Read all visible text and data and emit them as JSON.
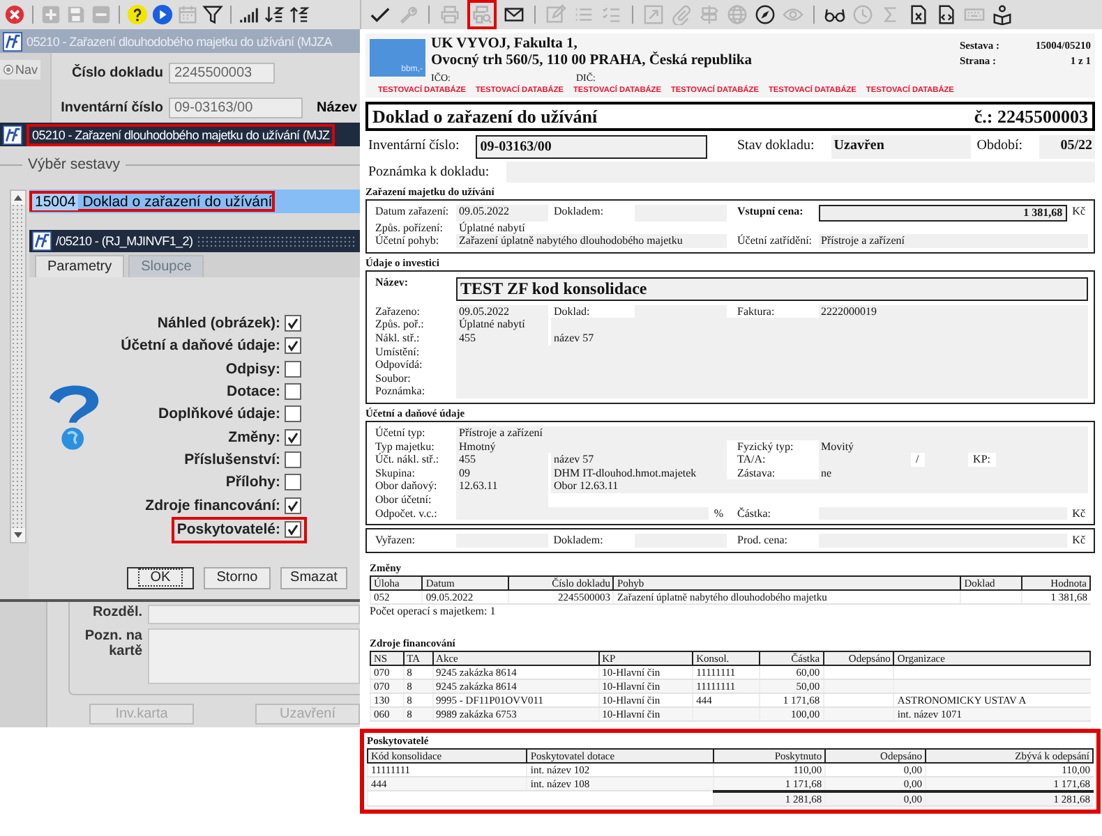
{
  "left": {
    "toolbar": [
      {
        "kind": "close",
        "disabled": false
      },
      {
        "kind": "separator"
      },
      {
        "kind": "add",
        "disabled": true
      },
      {
        "kind": "save",
        "disabled": true
      },
      {
        "kind": "remove",
        "disabled": true
      },
      {
        "kind": "separator"
      },
      {
        "kind": "help",
        "disabled": false
      },
      {
        "kind": "play",
        "disabled": false
      },
      {
        "kind": "calendar",
        "disabled": true
      },
      {
        "kind": "filter",
        "disabled": false
      },
      {
        "kind": "separator"
      },
      {
        "kind": "signal",
        "disabled": false
      },
      {
        "kind": "sort-down",
        "disabled": false
      },
      {
        "kind": "sort-up",
        "disabled": false
      }
    ],
    "back_window": {
      "title": "05210 - Zařazení dlouhodobého majetku do užívání (MJZA",
      "nav_button": "Nav",
      "fields": [
        {
          "label": "Číslo dokladu",
          "value": "2245500003"
        },
        {
          "label": "Inventární číslo",
          "value": "09-03163/00"
        }
      ],
      "cut_label": "Název"
    },
    "dialog": {
      "title": "05210 - Zařazení dlouhodobého majetku do užívání (MJZ",
      "highlighted": true,
      "group_label": "Výběr sestavy",
      "reports": [
        {
          "code": "15004",
          "name": "Doklad o zařazení do užívání",
          "selected": true,
          "highlighted": true
        }
      ],
      "subtitle": "/05210 - (RJ_MJINVF1_2)",
      "tabs": [
        {
          "label": "Parametry",
          "selected": true,
          "disabled": false
        },
        {
          "label": "Sloupce",
          "selected": false,
          "disabled": true
        }
      ],
      "options": [
        {
          "label": "Náhled (obrázek):",
          "checked": true,
          "highlighted": false
        },
        {
          "label": "Účetní a daňové údaje:",
          "checked": true,
          "highlighted": false
        },
        {
          "label": "Odpisy:",
          "checked": false,
          "highlighted": false
        },
        {
          "label": "Dotace:",
          "checked": false,
          "highlighted": false
        },
        {
          "label": "Doplňkové údaje:",
          "checked": false,
          "highlighted": false
        },
        {
          "label": "Změny:",
          "checked": true,
          "highlighted": false
        },
        {
          "label": "Příslušenství:",
          "checked": false,
          "highlighted": false
        },
        {
          "label": "Přílohy:",
          "checked": false,
          "highlighted": false
        },
        {
          "label": "Zdroje financování:",
          "checked": true,
          "highlighted": false
        },
        {
          "label": "Poskytovatelé:",
          "checked": true,
          "highlighted": true
        }
      ],
      "buttons": [
        {
          "label": "OK",
          "focused": true
        },
        {
          "label": "Storno",
          "focused": false
        },
        {
          "label": "Smazat",
          "focused": false
        }
      ]
    },
    "lower_form": {
      "fields": [
        {
          "label": "Rozděl.",
          "kind": "line"
        },
        {
          "label": "Pozn. na kartě",
          "kind": "area"
        }
      ],
      "buttons": [
        {
          "label": "Inv.karta",
          "disabled": true
        },
        {
          "label": "Uzavření",
          "disabled": true
        }
      ]
    }
  },
  "preview": {
    "toolbar": [
      {
        "kind": "check",
        "disabled": false,
        "highlighted": false
      },
      {
        "kind": "wrench",
        "disabled": true,
        "highlighted": false
      },
      {
        "kind": "separator"
      },
      {
        "kind": "print",
        "disabled": true,
        "highlighted": false
      },
      {
        "kind": "preview",
        "disabled": true,
        "highlighted": true
      },
      {
        "kind": "mail",
        "disabled": false,
        "highlighted": false
      },
      {
        "kind": "separator"
      },
      {
        "kind": "edit",
        "disabled": true,
        "highlighted": false
      },
      {
        "kind": "list",
        "disabled": true,
        "highlighted": false
      },
      {
        "kind": "checklist",
        "disabled": true,
        "highlighted": false
      },
      {
        "kind": "separator"
      },
      {
        "kind": "export",
        "disabled": true,
        "highlighted": false
      },
      {
        "kind": "clip",
        "disabled": true,
        "highlighted": false
      },
      {
        "kind": "signpost",
        "disabled": true,
        "highlighted": false
      },
      {
        "kind": "globe",
        "disabled": true,
        "highlighted": false
      },
      {
        "kind": "compass",
        "disabled": false,
        "highlighted": false
      },
      {
        "kind": "eye",
        "disabled": true,
        "highlighted": false
      },
      {
        "kind": "separator"
      },
      {
        "kind": "glasses",
        "disabled": false,
        "highlighted": false
      },
      {
        "kind": "clock",
        "disabled": true,
        "highlighted": false
      },
      {
        "kind": "sigma",
        "disabled": true,
        "highlighted": false
      },
      {
        "kind": "excel",
        "disabled": false,
        "highlighted": false
      },
      {
        "kind": "code",
        "disabled": false,
        "highlighted": false
      },
      {
        "kind": "keyboard",
        "disabled": true,
        "highlighted": false
      },
      {
        "kind": "reader",
        "disabled": false,
        "highlighted": false
      }
    ],
    "report": {
      "logo_text": "bbm,-",
      "company_lines": [
        "UK VYVOJ, Fakulta 1,",
        "Ovocný trh 560/5, 110 00 PRAHA, Česká republika"
      ],
      "ids": [
        "IČO:",
        "DIČ:"
      ],
      "meta": [
        {
          "label": "Sestava :",
          "value": "15004/05210"
        },
        {
          "label": "Strana :",
          "value": "1 z 1"
        }
      ],
      "test_banners": [
        "TESTOVACÍ DATABÁZE",
        "TESTOVACÍ DATABÁZE",
        "TESTOVACÍ DATABÁZE",
        "TESTOVACÍ DATABÁZE",
        "TESTOVACÍ DATABÁZE",
        "TESTOVACÍ DATABÁZE"
      ],
      "title": "Doklad o zařazení do užívání",
      "number": "č.: 2245500003",
      "sections": [
        {
          "kind": "plain",
          "rows": [
            {
              "left": [
                {
                  "kind": "label",
                  "text": "Inventární číslo:"
                },
                {
                  "kind": "boxed",
                  "text": "09-03163/00"
                }
              ],
              "right": [
                {
                  "kind": "label",
                  "text": "Stav dokladu:"
                },
                {
                  "kind": "strong-value",
                  "text": "Uzavřen"
                },
                {
                  "kind": "label",
                  "text": "Období:"
                },
                {
                  "kind": "strong-value",
                  "text": "05/22"
                }
              ]
            },
            {
              "left": [
                {
                  "kind": "label",
                  "text": "Poznámka k dokladu:"
                },
                {
                  "kind": "fill"
                }
              ]
            }
          ]
        },
        {
          "kind": "box",
          "title": "Zařazení majetku do užívání",
          "rows": [
            {
              "left": [
                {
                  "kind": "label",
                  "text": "Datum zařazení:"
                },
                {
                  "kind": "value",
                  "text": "09.05.2022"
                },
                {
                  "kind": "label",
                  "text": "Dokladem:"
                },
                {
                  "kind": "fill"
                }
              ],
              "right": [
                {
                  "kind": "strong",
                  "text": "Vstupní cena:"
                },
                {
                  "kind": "amount",
                  "text": "1 381,68"
                },
                {
                  "kind": "unit",
                  "text": "Kč"
                }
              ]
            },
            {
              "left": [
                {
                  "kind": "label",
                  "text": "Způs. pořízení:"
                },
                {
                  "kind": "text",
                  "text": "Úplatné nabytí"
                }
              ]
            },
            {
              "left": [
                {
                  "kind": "label",
                  "text": "Účetní pohyb:"
                },
                {
                  "kind": "fill",
                  "text": "Zařazení úplatně nabytého dlouhodobého majetku"
                }
              ],
              "right": [
                {
                  "kind": "label",
                  "text": "Účetní zatřídění:"
                },
                {
                  "kind": "fill",
                  "text": "Přístroje a zařízení"
                }
              ]
            }
          ]
        },
        {
          "kind": "box",
          "title": "Údaje o investici",
          "rows": [
            {
              "left": [
                {
                  "kind": "strong",
                  "text": "Název:"
                },
                {
                  "kind": "headline",
                  "text": "TEST ZF kod konsolidace"
                }
              ]
            },
            {
              "left": [
                {
                  "kind": "label",
                  "text": "Zařazeno:"
                },
                {
                  "kind": "value",
                  "text": "09.05.2022"
                },
                {
                  "kind": "label",
                  "text": "Doklad:"
                },
                {
                  "kind": "fill"
                }
              ],
              "right": [
                {
                  "kind": "label",
                  "text": "Faktura:"
                },
                {
                  "kind": "fill",
                  "text": "2222000019"
                }
              ]
            },
            {
              "left": [
                {
                  "kind": "label",
                  "text": "Způs. poř.:"
                },
                {
                  "kind": "value",
                  "text": "Úplatné nabytí"
                },
                {
                  "kind": "fill"
                }
              ]
            },
            {
              "left": [
                {
                  "kind": "label",
                  "text": "Nákl. stř.:"
                },
                {
                  "kind": "value",
                  "text": "455"
                },
                {
                  "kind": "fill",
                  "text": "název 57"
                }
              ]
            },
            {
              "left": [
                {
                  "kind": "label",
                  "text": "Umístění:"
                },
                {
                  "kind": "fill"
                }
              ]
            },
            {
              "left": [
                {
                  "kind": "label",
                  "text": "Odpovídá:"
                },
                {
                  "kind": "fill"
                }
              ]
            },
            {
              "left": [
                {
                  "kind": "label",
                  "text": "Soubor:"
                },
                {
                  "kind": "fill"
                }
              ]
            },
            {
              "left": [
                {
                  "kind": "label",
                  "text": "Poznámka:"
                },
                {
                  "kind": "fill"
                }
              ]
            }
          ]
        },
        {
          "kind": "box",
          "title": "Účetní a daňové údaje",
          "rows": [
            {
              "left": [
                {
                  "kind": "label",
                  "text": "Účetní typ:"
                },
                {
                  "kind": "fill",
                  "text": "Přístroje a zařízení"
                }
              ]
            },
            {
              "left": [
                {
                  "kind": "label",
                  "text": "Typ majetku:"
                },
                {
                  "kind": "fill",
                  "text": "Hmotný"
                }
              ],
              "right": [
                {
                  "kind": "label",
                  "text": "Fyzický typ:"
                },
                {
                  "kind": "fill",
                  "text": "Movitý"
                }
              ]
            },
            {
              "left": [
                {
                  "kind": "label",
                  "text": "Účt. nákl. stř.:"
                },
                {
                  "kind": "value",
                  "text": "455"
                },
                {
                  "kind": "fill",
                  "text": "název 57"
                }
              ],
              "right": [
                {
                  "kind": "label",
                  "text": "TA/A:"
                },
                {
                  "kind": "value"
                },
                {
                  "kind": "unit",
                  "text": "/"
                },
                {
                  "kind": "fill"
                },
                {
                  "kind": "unit",
                  "text": "KP:"
                },
                {
                  "kind": "value"
                }
              ]
            },
            {
              "left": [
                {
                  "kind": "label",
                  "text": "Skupina:"
                },
                {
                  "kind": "value",
                  "text": "09"
                },
                {
                  "kind": "fill",
                  "text": "DHM IT-dlouhod.hmot.majetek"
                }
              ],
              "right": [
                {
                  "kind": "label",
                  "text": "Zástava:"
                },
                {
                  "kind": "fill",
                  "text": "ne"
                }
              ]
            },
            {
              "left": [
                {
                  "kind": "label",
                  "text": "Obor daňový:"
                },
                {
                  "kind": "value",
                  "text": "12.63.11"
                },
                {
                  "kind": "fill",
                  "text": "Obor 12.63.11"
                }
              ]
            },
            {
              "left": [
                {
                  "kind": "label",
                  "text": "Obor účetní:"
                },
                {
                  "kind": "value"
                }
              ]
            },
            {
              "left": [
                {
                  "kind": "label",
                  "text": "Odpočet. v.c.:"
                },
                {
                  "kind": "fill"
                },
                {
                  "kind": "unit",
                  "text": "%"
                }
              ],
              "right": [
                {
                  "kind": "label",
                  "text": "Částka:"
                },
                {
                  "kind": "fill"
                },
                {
                  "kind": "unit",
                  "text": "Kč"
                }
              ]
            }
          ]
        },
        {
          "kind": "box",
          "rows": [
            {
              "left": [
                {
                  "kind": "label",
                  "text": "Vyřazen:"
                },
                {
                  "kind": "fill"
                },
                {
                  "kind": "label",
                  "text": "Dokladem:"
                },
                {
                  "kind": "fill"
                }
              ],
              "right": [
                {
                  "kind": "label",
                  "text": "Prod. cena:"
                },
                {
                  "kind": "fill"
                },
                {
                  "kind": "unit",
                  "text": "Kč"
                }
              ]
            }
          ]
        }
      ],
      "tables": [
        {
          "title": "Změny",
          "highlighted": false,
          "columns": [
            {
              "label": "Úloha",
              "numeric": false
            },
            {
              "label": "Datum",
              "numeric": false
            },
            {
              "label": "Číslo dokladu",
              "numeric": true
            },
            {
              "label": "Pohyb",
              "numeric": false
            },
            {
              "label": "Doklad",
              "numeric": false
            },
            {
              "label": "Hodnota",
              "numeric": true
            }
          ],
          "rows": [
            [
              "052",
              "09.05.2022",
              "2245500003",
              "Zařazení úplatně nabytého dlouhodobého majetku",
              null,
              "1 381,68"
            ]
          ],
          "note": "Počet operací s majetkem: 1"
        },
        {
          "title": "Zdroje financování",
          "highlighted": false,
          "columns": [
            {
              "label": "NS",
              "numeric": false
            },
            {
              "label": "TA",
              "numeric": false
            },
            {
              "label": "Akce",
              "numeric": false
            },
            {
              "label": "KP",
              "numeric": false
            },
            {
              "label": "Konsol.",
              "numeric": false
            },
            {
              "label": "Částka",
              "numeric": true
            },
            {
              "label": "Odepsáno",
              "numeric": true
            },
            {
              "label": "Organizace",
              "numeric": false
            }
          ],
          "rows": [
            [
              "070",
              "8",
              "9245 zakázka 8614",
              "10-Hlavní čin",
              "11111111",
              "60,00",
              null,
              null
            ],
            [
              "070",
              "8",
              "9245 zakázka 8614",
              "10-Hlavní čin",
              "11111111",
              "50,00",
              null,
              null
            ],
            [
              "130",
              "8",
              "9995 -  DF11P01OVV011",
              "10-Hlavní čin",
              "444",
              "1 171,68",
              null,
              "ASTRONOMICKY USTAV A"
            ],
            [
              "060",
              "8",
              "9989 zakázka 6753",
              "10-Hlavní čin",
              null,
              "100,00",
              null,
              "int. název 1071"
            ]
          ]
        },
        {
          "title": "Poskytovatelé",
          "highlighted": true,
          "columns": [
            {
              "label": "Kód konsolidace",
              "numeric": false
            },
            {
              "label": "Poskytovatel dotace",
              "numeric": false
            },
            {
              "label": "Poskytnuto",
              "numeric": true
            },
            {
              "label": "Odepsáno",
              "numeric": true
            },
            {
              "label": "Zbývá k odepsání",
              "numeric": true
            }
          ],
          "rows": [
            [
              "11111111",
              "int. název 102",
              "110,00",
              "0,00",
              "110,00"
            ],
            [
              "444",
              "int. název 108",
              "1 171,68",
              "0,00",
              "1 171,68"
            ]
          ],
          "totals": [
            "1 281,68",
            "0,00",
            "1 281,68"
          ]
        }
      ]
    }
  }
}
